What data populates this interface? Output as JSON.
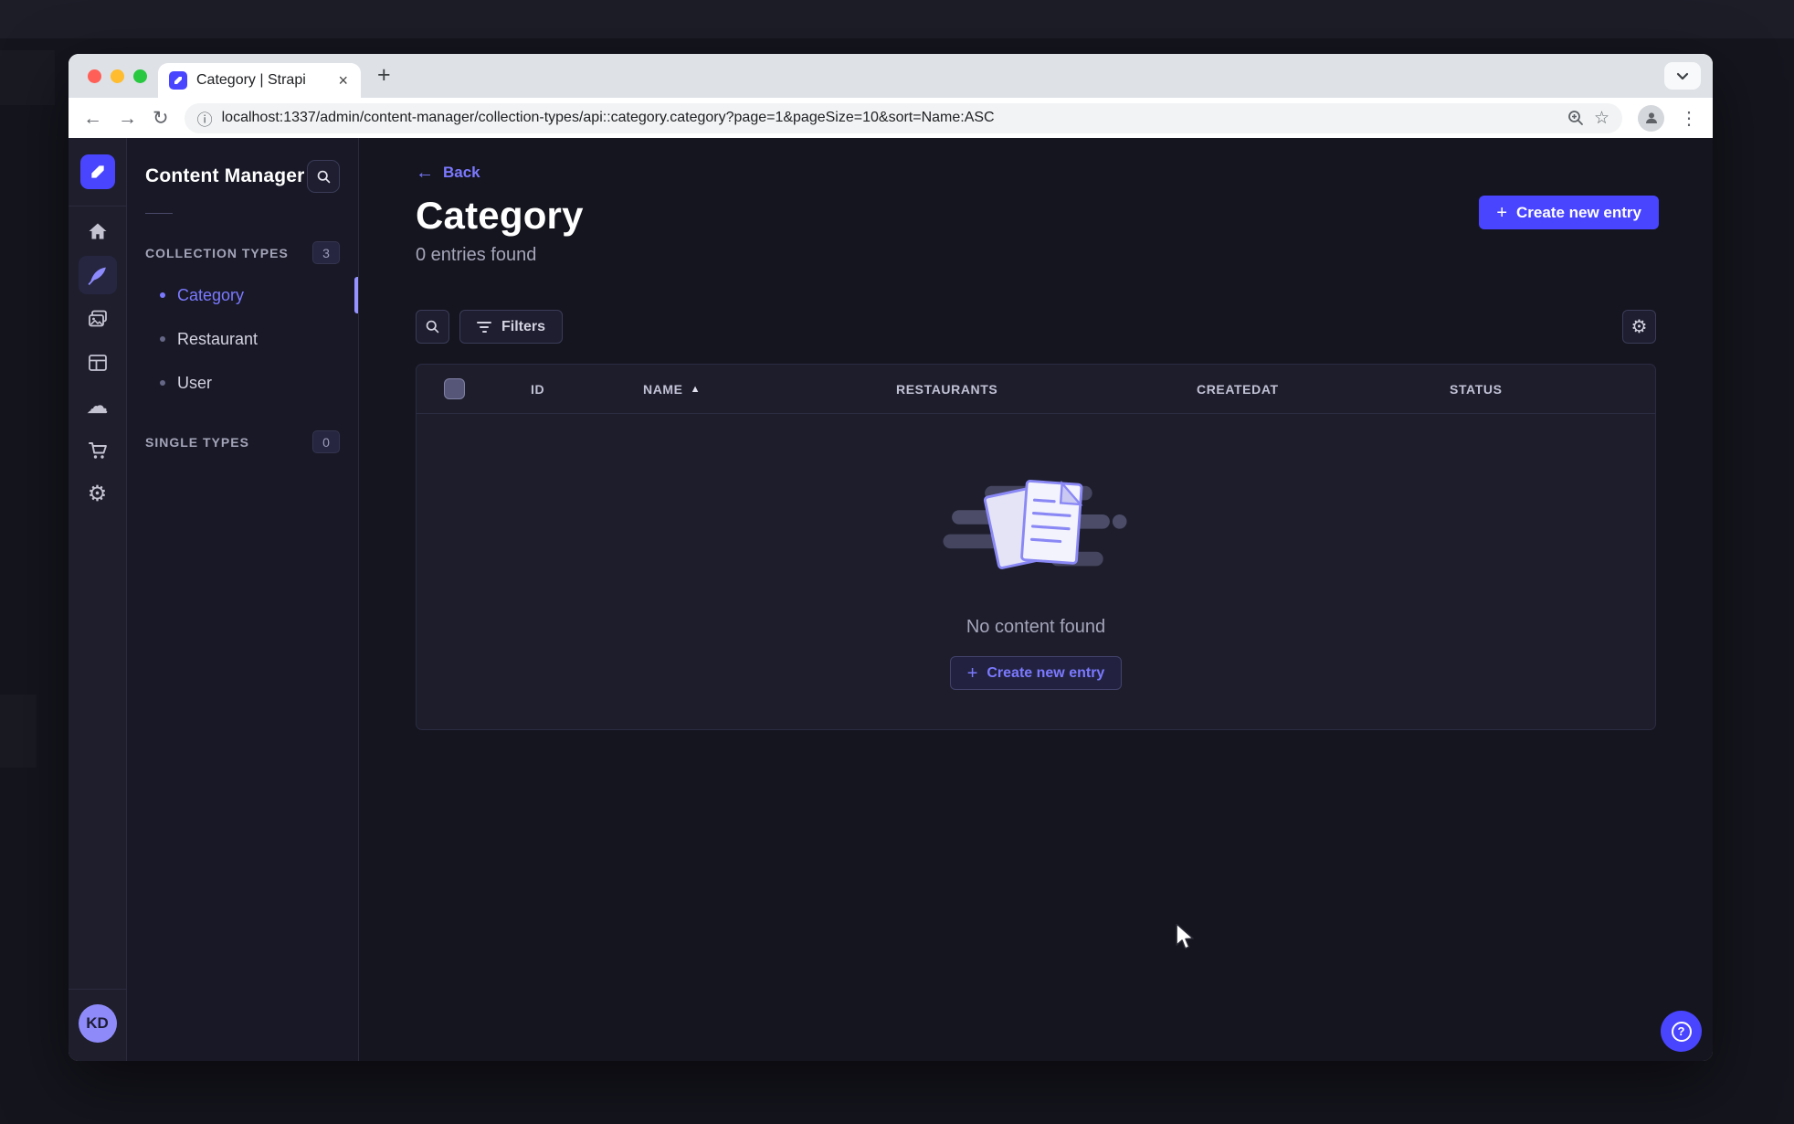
{
  "colors": {
    "primary": "#4945ff",
    "accent": "#7b79ff",
    "traffic_red": "#ff5f57",
    "traffic_yellow": "#febc2e",
    "traffic_green": "#28c840"
  },
  "browser": {
    "tab_title": "Category | Strapi",
    "close_glyph": "×",
    "new_tab_glyph": "+",
    "back_glyph": "←",
    "forward_glyph": "→",
    "reload_glyph": "↻",
    "info_glyph": "ⓘ",
    "url": "localhost:1337/admin/content-manager/collection-types/api::category.category?page=1&pageSize=10&sort=Name:ASC",
    "star_glyph": "☆",
    "menu_glyph": "⋮"
  },
  "rail": {
    "icons": [
      "strapi-logo",
      "home",
      "content-manager",
      "media-library",
      "content-type-builder",
      "deploy",
      "marketplace",
      "settings"
    ],
    "cloud_glyph": "☁",
    "gear_glyph": "⚙",
    "avatar_initials": "KD"
  },
  "subnav": {
    "title": "Content Manager",
    "sections": [
      {
        "label": "COLLECTION TYPES",
        "count": "3",
        "items": [
          {
            "label": "Category",
            "active": true
          },
          {
            "label": "Restaurant",
            "active": false
          },
          {
            "label": "User",
            "active": false
          }
        ]
      },
      {
        "label": "SINGLE TYPES",
        "count": "0",
        "items": []
      }
    ]
  },
  "main": {
    "back_label": "Back",
    "back_glyph": "←",
    "title": "Category",
    "subtitle": "0 entries found",
    "create_button": "Create new entry",
    "plus_glyph": "+",
    "filters_button": "Filters",
    "settings_glyph": "⚙",
    "table": {
      "headers": {
        "id": "ID",
        "name": "NAME",
        "restaurants": "RESTAURANTS",
        "createdat": "CREATEDAT",
        "status": "STATUS"
      },
      "sort_glyph": "▲"
    },
    "empty": {
      "message": "No content found",
      "create_button": "Create new entry",
      "plus_glyph": "+"
    }
  },
  "help": {
    "glyph": "?"
  }
}
